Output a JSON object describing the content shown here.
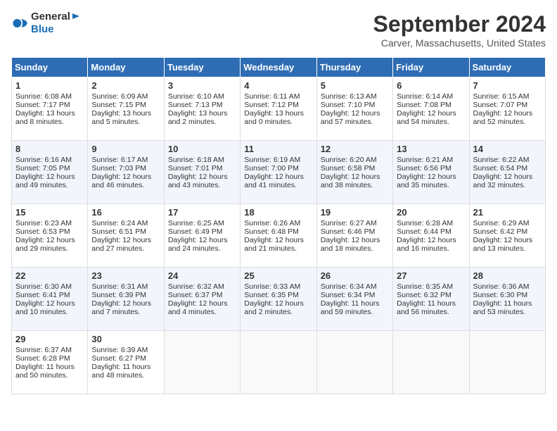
{
  "header": {
    "logo_general": "General",
    "logo_blue": "Blue",
    "month_year": "September 2024",
    "location": "Carver, Massachusetts, United States"
  },
  "days_of_week": [
    "Sunday",
    "Monday",
    "Tuesday",
    "Wednesday",
    "Thursday",
    "Friday",
    "Saturday"
  ],
  "weeks": [
    [
      {
        "day": "1",
        "sunrise": "6:08 AM",
        "sunset": "7:17 PM",
        "daylight": "13 hours and 8 minutes."
      },
      {
        "day": "2",
        "sunrise": "6:09 AM",
        "sunset": "7:15 PM",
        "daylight": "13 hours and 5 minutes."
      },
      {
        "day": "3",
        "sunrise": "6:10 AM",
        "sunset": "7:13 PM",
        "daylight": "13 hours and 2 minutes."
      },
      {
        "day": "4",
        "sunrise": "6:11 AM",
        "sunset": "7:12 PM",
        "daylight": "13 hours and 0 minutes."
      },
      {
        "day": "5",
        "sunrise": "6:13 AM",
        "sunset": "7:10 PM",
        "daylight": "12 hours and 57 minutes."
      },
      {
        "day": "6",
        "sunrise": "6:14 AM",
        "sunset": "7:08 PM",
        "daylight": "12 hours and 54 minutes."
      },
      {
        "day": "7",
        "sunrise": "6:15 AM",
        "sunset": "7:07 PM",
        "daylight": "12 hours and 52 minutes."
      }
    ],
    [
      {
        "day": "8",
        "sunrise": "6:16 AM",
        "sunset": "7:05 PM",
        "daylight": "12 hours and 49 minutes."
      },
      {
        "day": "9",
        "sunrise": "6:17 AM",
        "sunset": "7:03 PM",
        "daylight": "12 hours and 46 minutes."
      },
      {
        "day": "10",
        "sunrise": "6:18 AM",
        "sunset": "7:01 PM",
        "daylight": "12 hours and 43 minutes."
      },
      {
        "day": "11",
        "sunrise": "6:19 AM",
        "sunset": "7:00 PM",
        "daylight": "12 hours and 41 minutes."
      },
      {
        "day": "12",
        "sunrise": "6:20 AM",
        "sunset": "6:58 PM",
        "daylight": "12 hours and 38 minutes."
      },
      {
        "day": "13",
        "sunrise": "6:21 AM",
        "sunset": "6:56 PM",
        "daylight": "12 hours and 35 minutes."
      },
      {
        "day": "14",
        "sunrise": "6:22 AM",
        "sunset": "6:54 PM",
        "daylight": "12 hours and 32 minutes."
      }
    ],
    [
      {
        "day": "15",
        "sunrise": "6:23 AM",
        "sunset": "6:53 PM",
        "daylight": "12 hours and 29 minutes."
      },
      {
        "day": "16",
        "sunrise": "6:24 AM",
        "sunset": "6:51 PM",
        "daylight": "12 hours and 27 minutes."
      },
      {
        "day": "17",
        "sunrise": "6:25 AM",
        "sunset": "6:49 PM",
        "daylight": "12 hours and 24 minutes."
      },
      {
        "day": "18",
        "sunrise": "6:26 AM",
        "sunset": "6:48 PM",
        "daylight": "12 hours and 21 minutes."
      },
      {
        "day": "19",
        "sunrise": "6:27 AM",
        "sunset": "6:46 PM",
        "daylight": "12 hours and 18 minutes."
      },
      {
        "day": "20",
        "sunrise": "6:28 AM",
        "sunset": "6:44 PM",
        "daylight": "12 hours and 16 minutes."
      },
      {
        "day": "21",
        "sunrise": "6:29 AM",
        "sunset": "6:42 PM",
        "daylight": "12 hours and 13 minutes."
      }
    ],
    [
      {
        "day": "22",
        "sunrise": "6:30 AM",
        "sunset": "6:41 PM",
        "daylight": "12 hours and 10 minutes."
      },
      {
        "day": "23",
        "sunrise": "6:31 AM",
        "sunset": "6:39 PM",
        "daylight": "12 hours and 7 minutes."
      },
      {
        "day": "24",
        "sunrise": "6:32 AM",
        "sunset": "6:37 PM",
        "daylight": "12 hours and 4 minutes."
      },
      {
        "day": "25",
        "sunrise": "6:33 AM",
        "sunset": "6:35 PM",
        "daylight": "12 hours and 2 minutes."
      },
      {
        "day": "26",
        "sunrise": "6:34 AM",
        "sunset": "6:34 PM",
        "daylight": "11 hours and 59 minutes."
      },
      {
        "day": "27",
        "sunrise": "6:35 AM",
        "sunset": "6:32 PM",
        "daylight": "11 hours and 56 minutes."
      },
      {
        "day": "28",
        "sunrise": "6:36 AM",
        "sunset": "6:30 PM",
        "daylight": "11 hours and 53 minutes."
      }
    ],
    [
      {
        "day": "29",
        "sunrise": "6:37 AM",
        "sunset": "6:28 PM",
        "daylight": "11 hours and 50 minutes."
      },
      {
        "day": "30",
        "sunrise": "6:39 AM",
        "sunset": "6:27 PM",
        "daylight": "11 hours and 48 minutes."
      },
      null,
      null,
      null,
      null,
      null
    ]
  ]
}
